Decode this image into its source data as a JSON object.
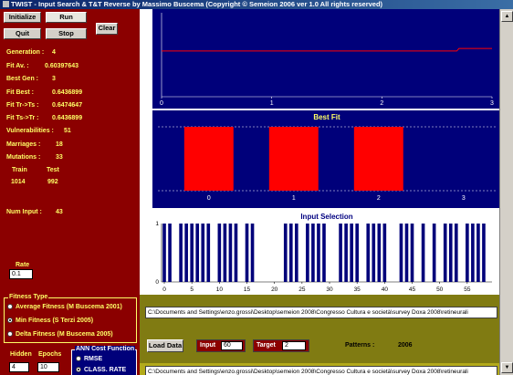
{
  "window": {
    "title": "TWIST - Input Search & T&T Reverse  by Massimo Buscema (Copyright © Semeion 2006 ver 1.0  All rights reserved)"
  },
  "controls": {
    "initialize": "Initialize",
    "run": "Run",
    "quit": "Quit",
    "stop": "Stop",
    "clear": "Clear"
  },
  "stats": {
    "generation_label": "Generation :",
    "generation": "4",
    "fit_av_label": "Fit Av. :",
    "fit_av": "0.60397643",
    "best_gen_label": "Best Gen :",
    "best_gen": "3",
    "fit_best_label": "Fit Best :",
    "fit_best": "0.6436899",
    "fit_tr_ts_label": "Fit Tr->Ts :",
    "fit_tr_ts": "0.6474647",
    "fit_ts_tr_label": "Fit Ts->Tr :",
    "fit_ts_tr": "0.6436899",
    "vulnerabilities_label": "Vulnerabilities :",
    "vulnerabilities": "51",
    "marriages_label": "Marriages :",
    "marriages": "18",
    "mutations_label": "Mutations :",
    "mutations": "33",
    "train_label": "Train",
    "test_label": "Test",
    "train": "1014",
    "test": "992",
    "num_input_label": "Num Input :",
    "num_input": "43"
  },
  "rate": {
    "label": "Rate",
    "value": "0.1"
  },
  "fitness_type": {
    "title": "Fitness Type",
    "options": [
      {
        "label": "Average Fitness (M Buscema 2001)",
        "selected": false
      },
      {
        "label": "Min Fitness (S Terzi 2005)",
        "selected": true
      },
      {
        "label": "Delta Fitness (M Buscema 2005)",
        "selected": false
      }
    ]
  },
  "network": {
    "hidden_label": "Hidden",
    "hidden": "4",
    "epochs_label": "Epochs",
    "epochs": "10"
  },
  "ann_cost": {
    "title": "ANN Cost Function",
    "options": [
      {
        "label": "RMSE",
        "selected": false
      },
      {
        "label": "CLASS. RATE",
        "selected": true
      }
    ]
  },
  "paths": {
    "path1": "C:\\Documents and Settings\\enzo.grossi\\Desktop\\semeion 2008\\Congresso Cultura e società\\survey Doxa 2008\\retineurali",
    "path2": "C:\\Documents and Settings\\enzo.grossi\\Desktop\\semeion 2008\\Congresso Cultura e società\\survey Doxa 2008\\retineurali"
  },
  "io": {
    "load_data": "Load Data",
    "input_label": "Input",
    "input": "60",
    "target_label": "Target",
    "target": "2",
    "patterns_label": "Patterns :",
    "patterns": "2006"
  },
  "colors": {
    "left_panel": "#8b0000",
    "chart_bg": "#00007a",
    "bar_red": "#ff0000",
    "text_yellow": "#ffff66",
    "olive": "#807b12"
  },
  "chart_data": [
    {
      "type": "line",
      "x_ticks": [
        "0",
        "1",
        "2",
        "3"
      ],
      "y_ticks": [],
      "xlim": [
        0,
        3
      ],
      "series": [
        {
          "x": [
            0,
            2.68,
            2.7,
            3
          ],
          "y": [
            0.64,
            0.64,
            0.645,
            0.645
          ]
        }
      ]
    },
    {
      "type": "bar",
      "title": "Best Fit",
      "x_ticks": [
        "0",
        "1",
        "2",
        "3"
      ],
      "xlim": [
        -0.6,
        3.4
      ],
      "ylim": [
        0,
        1
      ],
      "bars": [
        {
          "x": 0,
          "value": 1
        },
        {
          "x": 1,
          "value": 1
        },
        {
          "x": 2,
          "value": 1
        }
      ]
    },
    {
      "type": "bar",
      "title": "Input Selection",
      "y_ticks": [
        "0",
        "1"
      ],
      "x_ticks": [
        "0",
        "5",
        "10",
        "15",
        "20",
        "25",
        "30",
        "35",
        "40",
        "45",
        "50",
        "55"
      ],
      "xlim": [
        -0.5,
        59.5
      ],
      "ylim": [
        0,
        1
      ],
      "values": [
        1,
        1,
        0,
        1,
        1,
        1,
        1,
        1,
        1,
        0,
        1,
        1,
        1,
        1,
        0,
        1,
        1,
        0,
        0,
        0,
        0,
        0,
        1,
        1,
        1,
        0,
        1,
        1,
        1,
        1,
        0,
        0,
        1,
        1,
        1,
        1,
        0,
        1,
        1,
        1,
        1,
        0,
        0,
        1,
        1,
        1,
        0,
        1,
        0,
        1,
        0,
        1,
        1,
        1,
        0,
        1,
        1,
        1,
        1,
        0
      ]
    }
  ]
}
